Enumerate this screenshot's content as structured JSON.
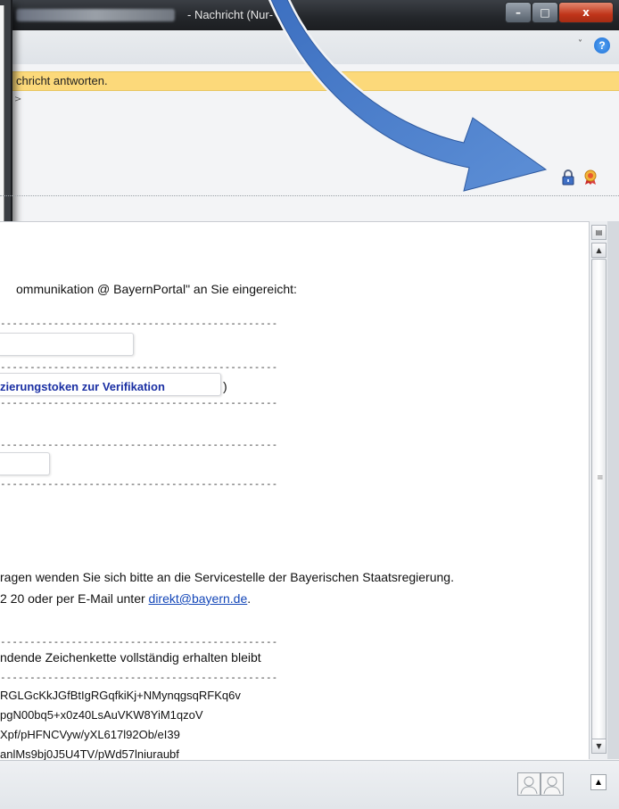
{
  "window": {
    "title_suffix": "- Nachricht (Nur-",
    "controls": {
      "minimize": "–",
      "maximize": "□",
      "close": "x"
    }
  },
  "ribbon": {
    "help": "?",
    "collapse": "˅"
  },
  "infobar": {
    "text": "chricht antworten."
  },
  "header": {
    "gt": ">"
  },
  "body": {
    "line1": "ommunikation @ BayernPortal\" an Sie eingereicht:",
    "dashes": "--------------------------------------------------------------------------------",
    "token_label": "zierungstoken zur Verifikation",
    "token_close": ")",
    "help_line1": "ragen wenden Sie sich bitte an die Servicestelle der Bayerischen Staatsregierung.",
    "help_line2_prefix": "2 20 oder per E-Mail unter ",
    "help_email": "direkt@bayern.de",
    "help_line2_suffix": ".",
    "keep_line": "ndende Zeichenkette vollständig erhalten bleibt",
    "b64_lines": [
      "RGLGcKkJGfBtIgRGqfkiKj+NMynqgsqRFKq6v",
      "pgN00bq5+x0z40LsAuVKW8YiM1qzoV",
      "Xpf/pHFNCVyw/yXL617l92Ob/eI39",
      "anlMs9bj0J5U4TV/pWd57lniuraubf"
    ]
  },
  "icons": {
    "lock": "lock-icon",
    "certificate": "certificate-icon",
    "arrow": "blue-arrow"
  }
}
